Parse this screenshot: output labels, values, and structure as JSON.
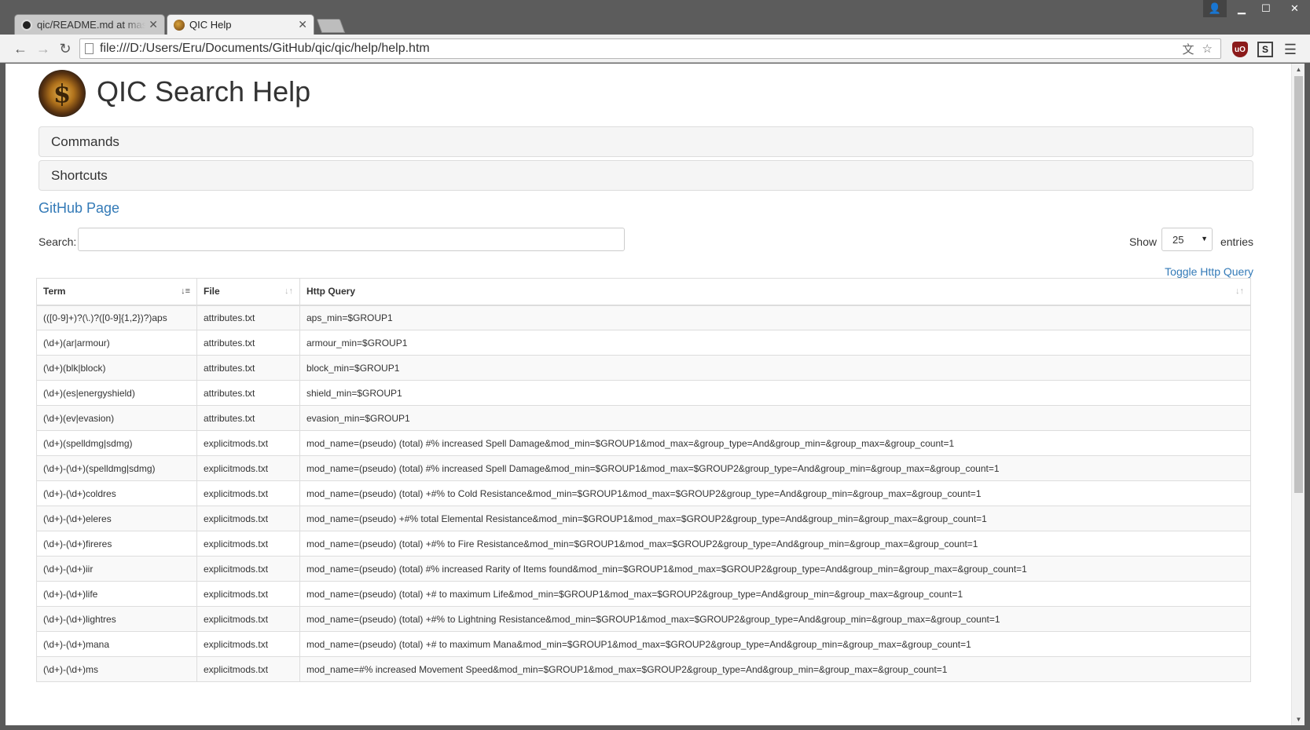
{
  "browser": {
    "tabs": [
      {
        "label": "qic/README.md at master",
        "icon": "github-icon",
        "active": false
      },
      {
        "label": "QIC Help",
        "icon": "qic-favicon",
        "active": true
      }
    ],
    "tab_close_glyph": "✕",
    "url": "file:///D:/Users/Eru/Documents/GitHub/qic/qic/help/help.htm",
    "window_controls": {
      "minimize": "▁",
      "maximize": "☐",
      "close": "✕",
      "user": "👤"
    },
    "nav": {
      "back": "←",
      "forward": "→",
      "reload": "↻"
    },
    "omnibox_icons": {
      "translate": "文",
      "star": "☆"
    },
    "extensions": {
      "ublock": "uO",
      "s_ext": "S",
      "menu": "☰"
    }
  },
  "page": {
    "title": "QIC Search Help",
    "logo_glyph": "$",
    "panels": [
      "Commands",
      "Shortcuts"
    ],
    "github_link": "GitHub Page",
    "search_label": "Search:",
    "search_value": "",
    "show_label": "Show",
    "entries_value": "25",
    "entries_label": "entries",
    "toggle_link": "Toggle Http Query"
  },
  "table": {
    "headers": [
      "Term",
      "File",
      "Http Query"
    ],
    "sort_active": "Term",
    "rows": [
      [
        "(([0-9]+)?(\\.)?([0-9]{1,2})?)aps",
        "attributes.txt",
        "aps_min=$GROUP1"
      ],
      [
        "(\\d+)(ar|armour)",
        "attributes.txt",
        "armour_min=$GROUP1"
      ],
      [
        "(\\d+)(blk|block)",
        "attributes.txt",
        "block_min=$GROUP1"
      ],
      [
        "(\\d+)(es|energyshield)",
        "attributes.txt",
        "shield_min=$GROUP1"
      ],
      [
        "(\\d+)(ev|evasion)",
        "attributes.txt",
        "evasion_min=$GROUP1"
      ],
      [
        "(\\d+)(spelldmg|sdmg)",
        "explicitmods.txt",
        "mod_name=(pseudo) (total) #% increased Spell Damage&mod_min=$GROUP1&mod_max=&group_type=And&group_min=&group_max=&group_count=1"
      ],
      [
        "(\\d+)-(\\d+)(spelldmg|sdmg)",
        "explicitmods.txt",
        "mod_name=(pseudo) (total) #% increased Spell Damage&mod_min=$GROUP1&mod_max=$GROUP2&group_type=And&group_min=&group_max=&group_count=1"
      ],
      [
        "(\\d+)-(\\d+)coldres",
        "explicitmods.txt",
        "mod_name=(pseudo) (total) +#% to Cold Resistance&mod_min=$GROUP1&mod_max=$GROUP2&group_type=And&group_min=&group_max=&group_count=1"
      ],
      [
        "(\\d+)-(\\d+)eleres",
        "explicitmods.txt",
        "mod_name=(pseudo) +#% total Elemental Resistance&mod_min=$GROUP1&mod_max=$GROUP2&group_type=And&group_min=&group_max=&group_count=1"
      ],
      [
        "(\\d+)-(\\d+)fireres",
        "explicitmods.txt",
        "mod_name=(pseudo) (total) +#% to Fire Resistance&mod_min=$GROUP1&mod_max=$GROUP2&group_type=And&group_min=&group_max=&group_count=1"
      ],
      [
        "(\\d+)-(\\d+)iir",
        "explicitmods.txt",
        "mod_name=(pseudo) (total) #% increased Rarity of Items found&mod_min=$GROUP1&mod_max=$GROUP2&group_type=And&group_min=&group_max=&group_count=1"
      ],
      [
        "(\\d+)-(\\d+)life",
        "explicitmods.txt",
        "mod_name=(pseudo) (total) +# to maximum Life&mod_min=$GROUP1&mod_max=$GROUP2&group_type=And&group_min=&group_max=&group_count=1"
      ],
      [
        "(\\d+)-(\\d+)lightres",
        "explicitmods.txt",
        "mod_name=(pseudo) (total) +#% to Lightning Resistance&mod_min=$GROUP1&mod_max=$GROUP2&group_type=And&group_min=&group_max=&group_count=1"
      ],
      [
        "(\\d+)-(\\d+)mana",
        "explicitmods.txt",
        "mod_name=(pseudo) (total) +# to maximum Mana&mod_min=$GROUP1&mod_max=$GROUP2&group_type=And&group_min=&group_max=&group_count=1"
      ],
      [
        "(\\d+)-(\\d+)ms",
        "explicitmods.txt",
        "mod_name=#% increased Movement Speed&mod_min=$GROUP1&mod_max=$GROUP2&group_type=And&group_min=&group_max=&group_count=1"
      ]
    ]
  }
}
